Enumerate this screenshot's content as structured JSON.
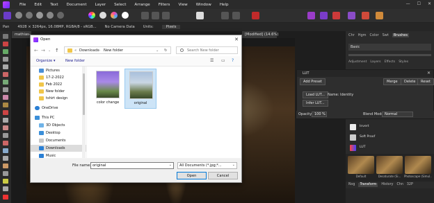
{
  "menu": [
    "File",
    "Edit",
    "Text",
    "Document",
    "Layer",
    "Select",
    "Arrange",
    "Filters",
    "View",
    "Window",
    "Help"
  ],
  "window_controls": [
    "—",
    "☐",
    "✕"
  ],
  "context_bar": {
    "tool": "Pan",
    "info": "4928 × 3264px, 16.08MP, RGBA/8 - sRGB...",
    "camera": "No Camera Data",
    "units_label": "Units:",
    "units_value": "Pixels"
  },
  "doc_tabs": [
    "mathias-...",
    "[Modified] (14.6%)"
  ],
  "right_panel": {
    "tabs": [
      "Chr",
      "Hgm",
      "Color",
      "Swt",
      "Brushes"
    ],
    "active_tab": "Brushes",
    "preset": "Basic",
    "lower_tabs": [
      "Adjustment",
      "Layers",
      "Effects",
      "Styles"
    ]
  },
  "lut_panel": {
    "title": "LUT",
    "close": "✕",
    "add_preset": "Add Preset",
    "merge": "Merge",
    "delete": "Delete",
    "reset": "Reset",
    "load_lut": "Load LUT...",
    "name_label": "Name: Identity",
    "infer_lut": "Infer LUT..."
  },
  "opacity_row": {
    "opacity_label": "Opacity:",
    "opacity_value": "100 %",
    "blend_label": "Blend Mode:",
    "blend_value": "Normal"
  },
  "layers": [
    "Invert",
    "Soft Proof",
    "LUT"
  ],
  "lut_presets": [
    "Default",
    "Desaturate (Si...",
    "Photoscape (Simul..."
  ],
  "bottom_tabs": [
    "Nvg",
    "Transform",
    "History",
    "Chn",
    "32P"
  ],
  "dialog": {
    "title": "Open",
    "close": "✕",
    "breadcrumb": [
      "«",
      "Downloads",
      "›",
      "New folder"
    ],
    "search_placeholder": "Search New folder",
    "organize": "Organize ▾",
    "new_folder": "New folder",
    "nav_items": [
      {
        "label": "Pictures",
        "icon": "pictures"
      },
      {
        "label": "17-2-2022",
        "icon": "folder"
      },
      {
        "label": "Feb 2022",
        "icon": "folder"
      },
      {
        "label": "New folder",
        "icon": "folder"
      },
      {
        "label": "tshirt design",
        "icon": "folder"
      },
      {
        "label": "OneDrive",
        "icon": "cloud"
      },
      {
        "label": "This PC",
        "icon": "pc"
      },
      {
        "label": "3D Objects",
        "icon": "cube"
      },
      {
        "label": "Desktop",
        "icon": "desktop"
      },
      {
        "label": "Documents",
        "icon": "documents"
      },
      {
        "label": "Downloads",
        "icon": "download"
      },
      {
        "label": "Music",
        "icon": "music"
      }
    ],
    "files": [
      {
        "label": "color change"
      },
      {
        "label": "original"
      }
    ],
    "file_name_label": "File name:",
    "file_name_value": "original",
    "filter_value": "All Documents (*.jpg;*...",
    "open_button": "Open",
    "cancel_button": "Cancel"
  }
}
